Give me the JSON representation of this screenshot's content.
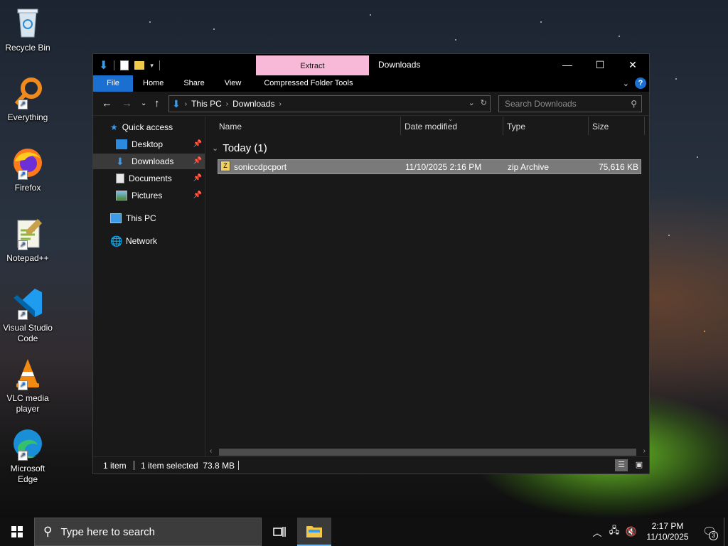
{
  "desktop": {
    "icons": [
      {
        "label": "Recycle Bin",
        "icon": "recycle-bin-icon"
      },
      {
        "label": "Everything",
        "icon": "everything-search-icon"
      },
      {
        "label": "Firefox",
        "icon": "firefox-icon"
      },
      {
        "label": "Notepad++",
        "icon": "notepad-plus-plus-icon"
      },
      {
        "label": "Visual Studio Code",
        "icon": "vscode-icon"
      },
      {
        "label": "VLC media player",
        "icon": "vlc-icon"
      },
      {
        "label": "Microsoft Edge",
        "icon": "edge-icon"
      }
    ]
  },
  "window": {
    "title": "Downloads",
    "contextual_tab": "Extract",
    "contextual_color": "#f8b8d8",
    "ribbon_tabs": [
      "File",
      "Home",
      "Share",
      "View",
      "Compressed Folder Tools"
    ],
    "address": {
      "crumbs": [
        "This PC",
        "Downloads"
      ]
    },
    "search_placeholder": "Search Downloads",
    "nav": {
      "quick_access": "Quick access",
      "items": [
        {
          "label": "Desktop",
          "pinned": true
        },
        {
          "label": "Downloads",
          "pinned": true,
          "selected": true
        },
        {
          "label": "Documents",
          "pinned": true
        },
        {
          "label": "Pictures",
          "pinned": true
        }
      ],
      "this_pc": "This PC",
      "network": "Network"
    },
    "columns": [
      "Name",
      "Date modified",
      "Type",
      "Size"
    ],
    "group_label": "Today (1)",
    "files": [
      {
        "name": "soniccdpcport",
        "date": "11/10/2025 2:16 PM",
        "type": "zip Archive",
        "size": "75,616 KB",
        "selected": true
      }
    ],
    "status": {
      "count": "1 item",
      "selection": "1 item selected  73.8 MB"
    }
  },
  "taskbar": {
    "search_placeholder": "Type here to search",
    "time": "2:17 PM",
    "date": "11/10/2025",
    "notification_count": "3"
  }
}
